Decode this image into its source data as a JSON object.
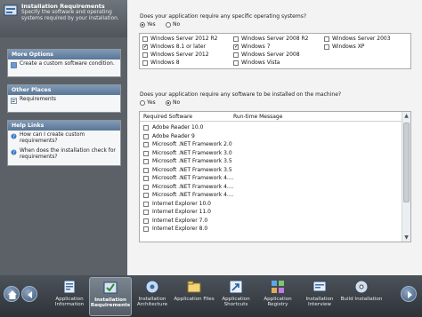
{
  "header": {
    "title": "Installation Requirements",
    "description": "Specify the software and operating systems required by your installation."
  },
  "sidebar": {
    "more_options": {
      "title": "More Options",
      "items": [
        "Create a custom software condition."
      ]
    },
    "other_places": {
      "title": "Other Places",
      "items": [
        "Requirements"
      ]
    },
    "help_links": {
      "title": "Help Links",
      "items": [
        "How can I create custom requirements?",
        "When does the installation check for requirements?"
      ]
    }
  },
  "os_question": {
    "text": "Does your application require any specific operating systems?",
    "yes": "Yes",
    "no": "No",
    "selected": "Yes"
  },
  "os_list": [
    {
      "label": "Windows Server 2012 R2",
      "checked": false
    },
    {
      "label": "Windows Server 2008 R2",
      "checked": false
    },
    {
      "label": "Windows Server 2003",
      "checked": false
    },
    {
      "label": "Windows 8.1 or later",
      "checked": true
    },
    {
      "label": "Windows 7",
      "checked": true
    },
    {
      "label": "Windows XP",
      "checked": false
    },
    {
      "label": "Windows Server 2012",
      "checked": false
    },
    {
      "label": "Windows Server 2008",
      "checked": false
    },
    {
      "label": "Windows 8",
      "checked": false
    },
    {
      "label": "Windows Vista",
      "checked": false
    }
  ],
  "sw_question": {
    "text": "Does your application require any software to be installed on the machine?",
    "yes": "Yes",
    "no": "No",
    "selected": "No"
  },
  "sw_table": {
    "col1": "Required Software",
    "col2": "Run-time Message",
    "rows": [
      "Adobe Reader 10.0",
      "Adobe Reader 9",
      "Microsoft .NET Framework 2.0",
      "Microsoft .NET Framework 3.0",
      "Microsoft .NET Framework 3.5",
      "Microsoft .NET Framework 3.5",
      "Microsoft .NET Framework 4....",
      "Microsoft .NET Framework 4....",
      "Microsoft .NET Framework 4....",
      "Internet Explorer 10.0",
      "Internet Explorer 11.0",
      "Internet Explorer 7.0",
      "Internet Explorer 8.0"
    ]
  },
  "taskbar": [
    {
      "label": "Application Information",
      "icon": "application-information-icon"
    },
    {
      "label": "Installation Requirements",
      "icon": "installation-requirements-icon",
      "active": true
    },
    {
      "label": "Installation Architecture",
      "icon": "installation-architecture-icon"
    },
    {
      "label": "Application Files",
      "icon": "application-files-icon"
    },
    {
      "label": "Application Shortcuts",
      "icon": "application-shortcuts-icon"
    },
    {
      "label": "Application Registry",
      "icon": "application-registry-icon"
    },
    {
      "label": "Installation Interview",
      "icon": "installation-interview-icon"
    },
    {
      "label": "Build Installation",
      "icon": "build-installation-icon"
    }
  ]
}
